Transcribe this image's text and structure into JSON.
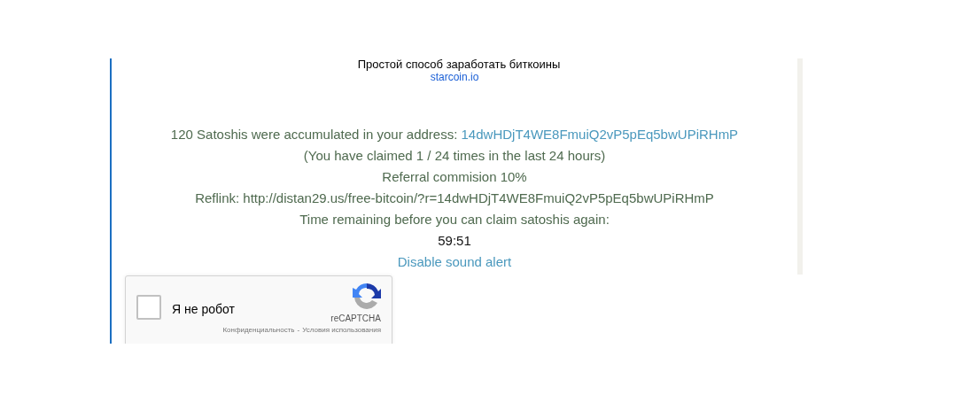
{
  "banner": {
    "tagline": "Простой способ заработать биткоины",
    "link": "starcoin.io"
  },
  "claim": {
    "accumulated_text": "120 Satoshis were accumulated in your address:",
    "address": "14dwHDjT4WE8FmuiQ2vP5pEq5bwUPiRHmP",
    "claimed": "(You have claimed 1 / 24 times in the last 24 hours)",
    "referral": "Referral commision 10%",
    "reflink": "Reflink: http://distan29.us/free-bitcoin/?r=14dwHDjT4WE8FmuiQ2vP5pEq5bwUPiRHmP",
    "time_label": "Time remaining before you can claim satoshis again:",
    "timer": "59:51",
    "sound_link": "Disable sound alert"
  },
  "captcha": {
    "label": "Я не робот",
    "checked": false,
    "brand": "reCAPTCHA",
    "privacy": "Конфиденциальность",
    "separator": "-",
    "terms": "Условия использования"
  }
}
